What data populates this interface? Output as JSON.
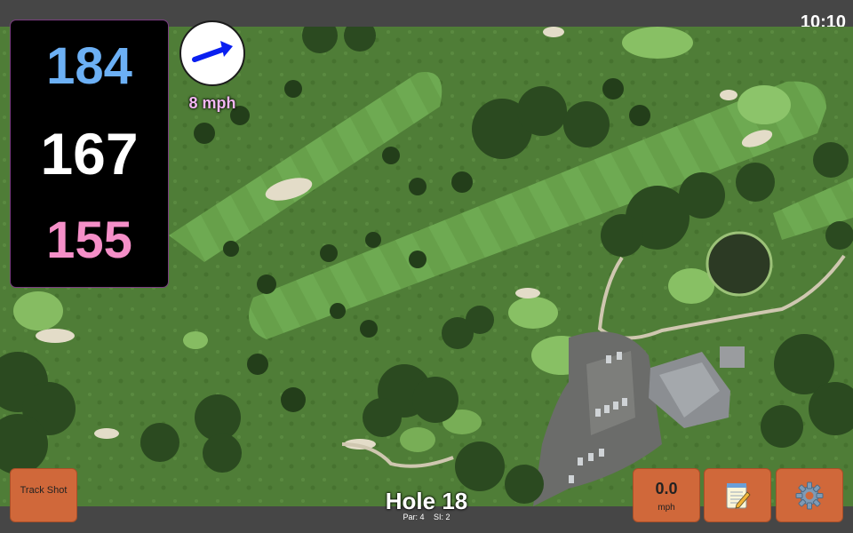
{
  "status": {
    "time": "10:10"
  },
  "distances": {
    "back": "184",
    "middle": "167",
    "front": "155"
  },
  "wind": {
    "speed_label": "8 mph"
  },
  "hole": {
    "title": "Hole 18",
    "par_label": "Par: 4",
    "si_label": "SI: 2"
  },
  "buttons": {
    "track_shot": "Track Shot",
    "speed_value": "0.0",
    "speed_unit": "mph",
    "notes_icon": "notepad-icon",
    "settings_icon": "gear-icon"
  },
  "colors": {
    "back_distance": "#6cb0f5",
    "middle_distance": "#ffffff",
    "front_distance": "#f58fc8",
    "button_orange": "#d0683a",
    "wind_arrow": "#0a1ff0"
  }
}
